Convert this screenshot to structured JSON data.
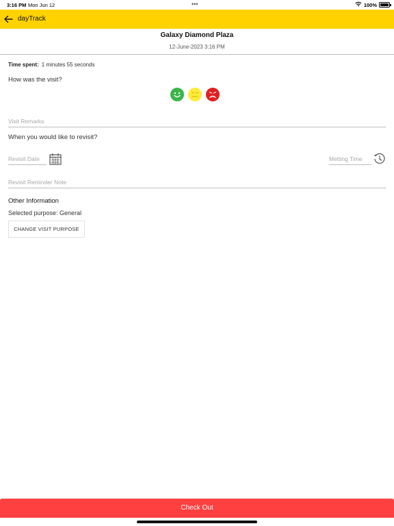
{
  "status_bar": {
    "time": "3:16 PM",
    "date": "Mon Jun 12",
    "dots": "•••",
    "battery": "100%"
  },
  "app_bar": {
    "title": "dayTrack",
    "background": "#ffd200"
  },
  "visit": {
    "place": "Galaxy Diamond Plaza",
    "datetime": "12-June-2023 3:16 PM",
    "time_spent_label": "Time spent:",
    "time_spent_value": "1 minutes 55 seconds"
  },
  "rating": {
    "question": "How was the visit?",
    "options": [
      {
        "name": "happy",
        "color": "#3bb54a"
      },
      {
        "name": "neutral",
        "color": "#ffeb3b"
      },
      {
        "name": "sad",
        "color": "#e02020"
      }
    ]
  },
  "form": {
    "remarks_placeholder": "Visit Remarks",
    "revisit_question": "When you would like to revisit?",
    "revisit_date_placeholder": "Revisit Date",
    "meeting_time_placeholder": "Metting Time",
    "reminder_placeholder": "Revisit Reminder Note"
  },
  "other_info": {
    "title": "Other Information",
    "purpose_text": "Selected purpose: General",
    "change_button": "CHANGE VISIT PURPOSE"
  },
  "checkout": {
    "label": "Check Out",
    "color": "#ff4040"
  }
}
